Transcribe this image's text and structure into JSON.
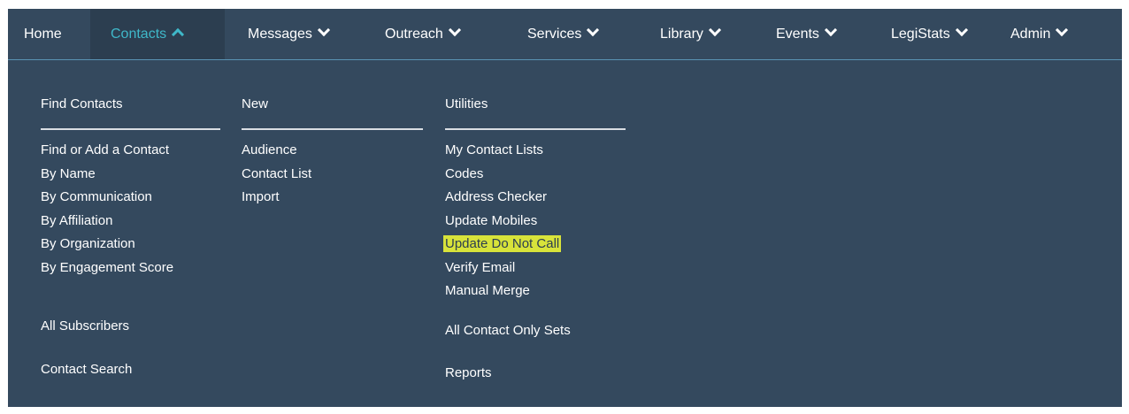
{
  "nav": {
    "items": [
      {
        "label": "Home",
        "name": "nav-home",
        "chevron": "none"
      },
      {
        "label": "Contacts",
        "name": "nav-contacts",
        "chevron": "up",
        "active": true
      },
      {
        "label": "Messages",
        "name": "nav-messages",
        "chevron": "down"
      },
      {
        "label": "Outreach",
        "name": "nav-outreach",
        "chevron": "down"
      },
      {
        "label": "Services",
        "name": "nav-services",
        "chevron": "down"
      },
      {
        "label": "Library",
        "name": "nav-library",
        "chevron": "down"
      },
      {
        "label": "Events",
        "name": "nav-events",
        "chevron": "down"
      },
      {
        "label": "LegiStats",
        "name": "nav-legistats",
        "chevron": "down"
      },
      {
        "label": "Admin",
        "name": "nav-admin",
        "chevron": "down"
      }
    ]
  },
  "menu": {
    "find_contacts": {
      "heading": "Find Contacts",
      "items": [
        "Find or Add a Contact",
        "By Name",
        "By Communication",
        "By Affiliation",
        "By Organization",
        "By Engagement Score"
      ],
      "all_subscribers": "All Subscribers",
      "contact_search": "Contact Search"
    },
    "new": {
      "heading": "New",
      "items": [
        "Audience",
        "Contact List",
        "Import"
      ]
    },
    "utilities": {
      "heading": "Utilities",
      "items": [
        "My Contact Lists",
        "Codes",
        "Address Checker",
        "Update Mobiles",
        "Update Do Not Call",
        "Verify Email",
        "Manual Merge"
      ],
      "all_contact_only_sets": "All Contact Only Sets",
      "reports": "Reports"
    }
  },
  "colors": {
    "panel_bg": "#34495e",
    "active_tab_bg": "#2c3e50",
    "active_tab_text": "#3fb8c9",
    "highlight": "#d8e33a"
  }
}
